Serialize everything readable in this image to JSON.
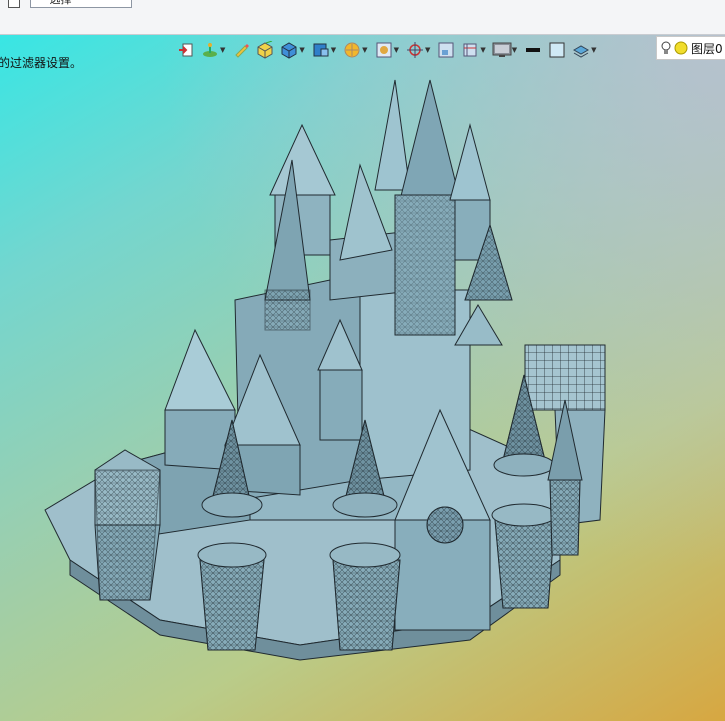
{
  "topbar": {
    "selector_value": "一 选择"
  },
  "viewport": {
    "hint_text": "的过滤器设置。",
    "background_colors": [
      "#38e6e4",
      "#98cfb1",
      "#b9cc8a",
      "#d7a741"
    ]
  },
  "toolbar": {
    "icons": [
      "layer-arrow-icon",
      "ucs-icon",
      "pencil-edit-icon",
      "box-yellow-icon",
      "box-blue-icon",
      "box-solid-icon",
      "display-mode-icon",
      "wireframe-icon",
      "target-icon",
      "view-small-icon",
      "dimension-icon",
      "monitor-icon",
      "line-weight-icon",
      "color-swatch-icon",
      "layer-stack-icon"
    ],
    "layer_label": "图层0"
  },
  "model": {
    "fill_color": "#8fb3c0",
    "edge_color": "#202a30"
  }
}
